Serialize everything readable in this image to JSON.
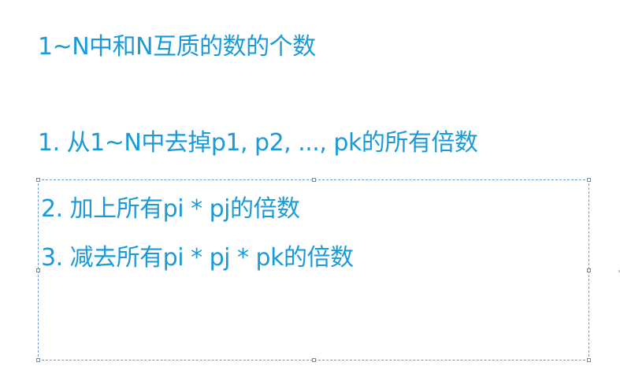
{
  "slide": {
    "title": "1~N中和N互质的数的个数",
    "steps": [
      "1. 从1~N中去掉p1, p2, ..., pk的所有倍数",
      "2. 加上所有pi * pj的倍数",
      "3. 减去所有pi * pj * pk的倍数"
    ]
  },
  "colors": {
    "text": "#1a9ad6",
    "selection_border": "#6a9cc9",
    "background": "#ffffff"
  }
}
